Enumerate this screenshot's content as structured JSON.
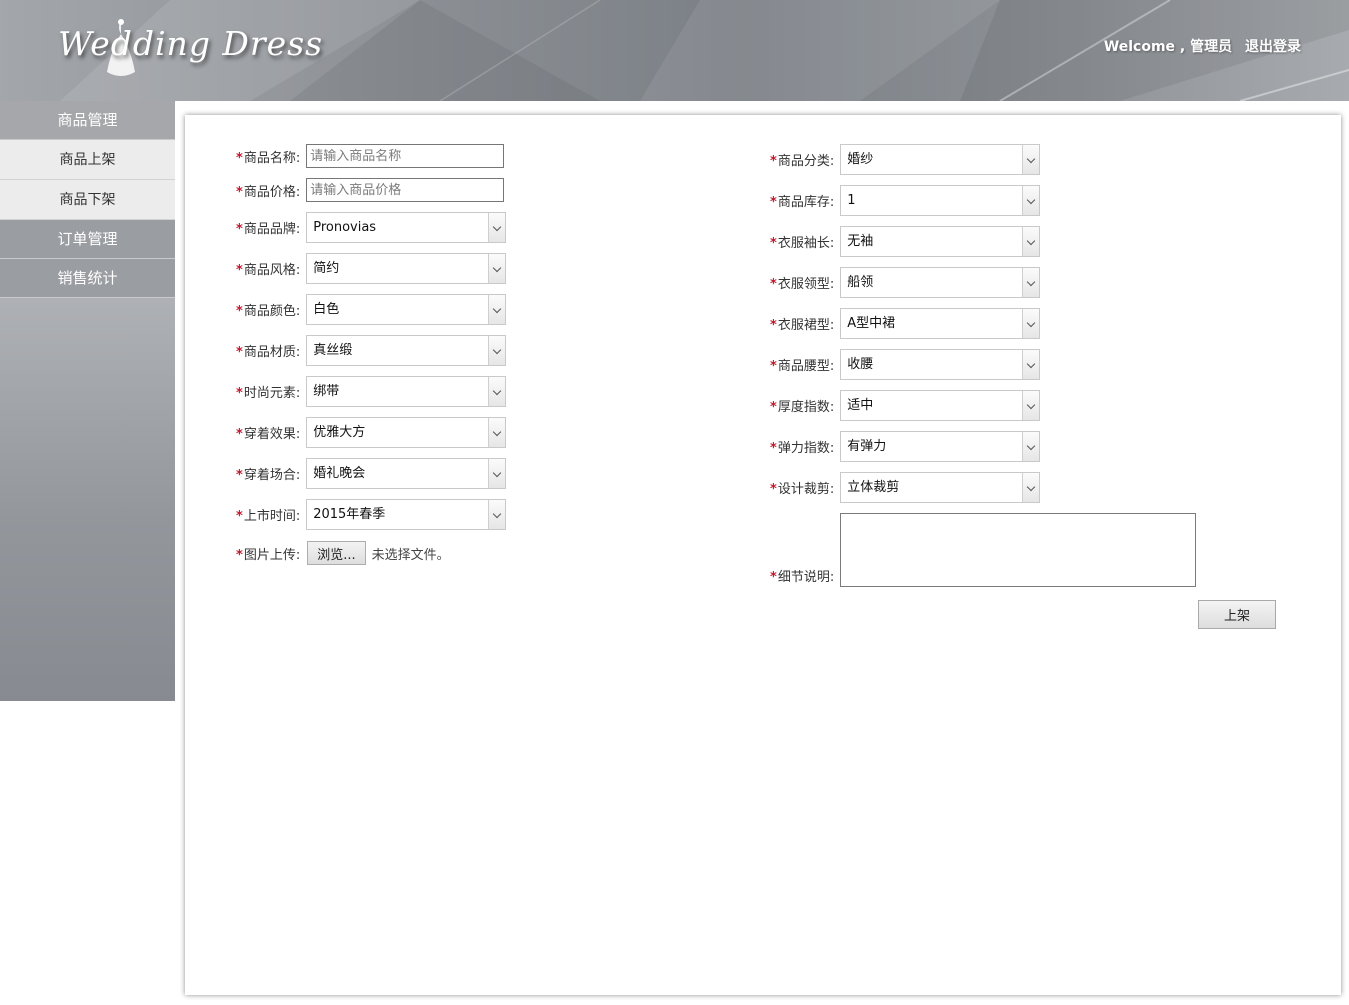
{
  "header": {
    "logo_text": "Wedding Dress",
    "welcome": "Welcome , 管理员",
    "logout": "退出登录"
  },
  "sidebar": {
    "groups": [
      {
        "label": "商品管理",
        "items": [
          {
            "label": "商品上架"
          },
          {
            "label": "商品下架"
          }
        ]
      },
      {
        "label": "订单管理"
      },
      {
        "label": "销售统计"
      }
    ]
  },
  "form": {
    "left": {
      "name_label": "商品名称:",
      "name_placeholder": "请输入商品名称",
      "price_label": "商品价格:",
      "price_placeholder": "请输入商品价格",
      "selects": [
        {
          "label": "商品品牌:",
          "value": "Pronovias"
        },
        {
          "label": "商品风格:",
          "value": "简约"
        },
        {
          "label": "商品颜色:",
          "value": "白色"
        },
        {
          "label": "商品材质:",
          "value": "真丝缎"
        },
        {
          "label": "时尚元素:",
          "value": "绑带"
        },
        {
          "label": "穿着效果:",
          "value": "优雅大方"
        },
        {
          "label": "穿着场合:",
          "value": "婚礼晚会"
        },
        {
          "label": "上市时间:",
          "value": "2015年春季"
        }
      ],
      "upload_label": "图片上传:",
      "browse_label": "浏览...",
      "file_status": "未选择文件。"
    },
    "right": {
      "selects": [
        {
          "label": "商品分类:",
          "value": "婚纱"
        },
        {
          "label": "商品库存:",
          "value": "1"
        },
        {
          "label": "衣服袖长:",
          "value": "无袖"
        },
        {
          "label": "衣服领型:",
          "value": "船领"
        },
        {
          "label": "衣服裙型:",
          "value": "A型中裙"
        },
        {
          "label": "商品腰型:",
          "value": "收腰"
        },
        {
          "label": "厚度指数:",
          "value": "适中"
        },
        {
          "label": "弹力指数:",
          "value": "有弹力"
        },
        {
          "label": "设计裁剪:",
          "value": "立体裁剪"
        }
      ],
      "detail_label": "细节说明:",
      "detail_value": ""
    },
    "required_mark": "*",
    "submit_label": "上架"
  },
  "colors": {
    "required": "#c0182b",
    "header_mid": "#7b8086",
    "sidebar_group": "#9a9da1"
  }
}
